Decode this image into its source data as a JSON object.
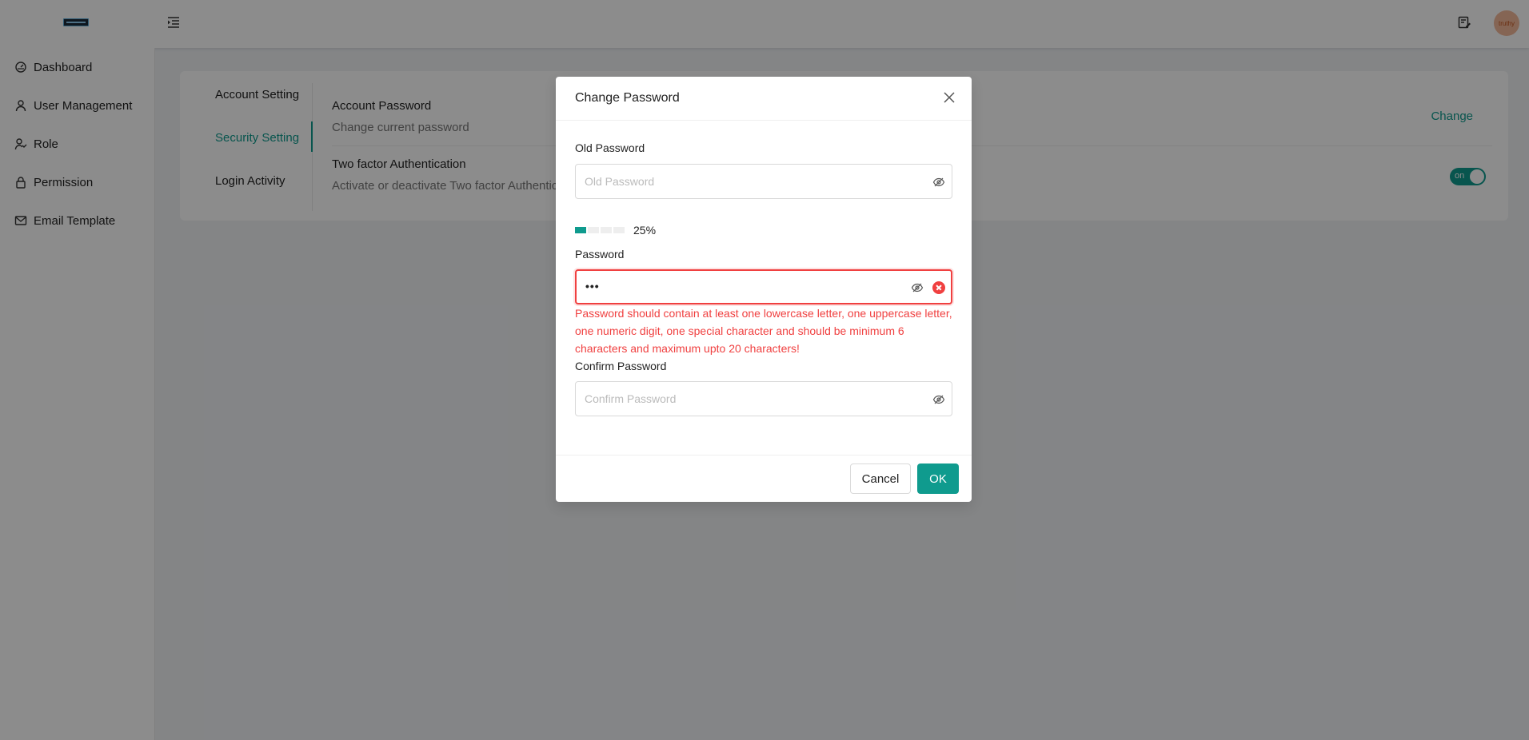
{
  "header": {
    "avatar_text": "truthy"
  },
  "sidebar": {
    "items": [
      {
        "label": "Dashboard",
        "icon": "dashboard-icon"
      },
      {
        "label": "User Management",
        "icon": "user-icon"
      },
      {
        "label": "Role",
        "icon": "role-icon"
      },
      {
        "label": "Permission",
        "icon": "lock-icon"
      },
      {
        "label": "Email Template",
        "icon": "mail-icon"
      }
    ]
  },
  "settings": {
    "tabs": [
      {
        "label": "Account Setting",
        "active": false
      },
      {
        "label": "Security Setting",
        "active": true
      },
      {
        "label": "Login Activity",
        "active": false
      }
    ],
    "rows": [
      {
        "title": "Account Password",
        "description": "Change current password",
        "action": "Change"
      },
      {
        "title": "Two factor Authentication",
        "description": "Activate or deactivate Two factor Authentication",
        "toggle_label": "on",
        "toggle_on": true
      }
    ]
  },
  "modal": {
    "title": "Change Password",
    "old_password": {
      "label": "Old Password",
      "placeholder": "Old Password",
      "value": ""
    },
    "strength": {
      "percent_text": "25%",
      "level": 0.25
    },
    "password": {
      "label": "Password",
      "value": "•••"
    },
    "error": "Password should contain at least one lowercase letter, one uppercase letter, one numeric digit, one special character and should be minimum 6 characters and maximum upto 20 characters!",
    "confirm_password": {
      "label": "Confirm Password",
      "placeholder": "Confirm Password",
      "value": ""
    },
    "cancel_label": "Cancel",
    "ok_label": "OK"
  },
  "colors": {
    "accent": "#0f9b8e",
    "error": "#f04040"
  }
}
